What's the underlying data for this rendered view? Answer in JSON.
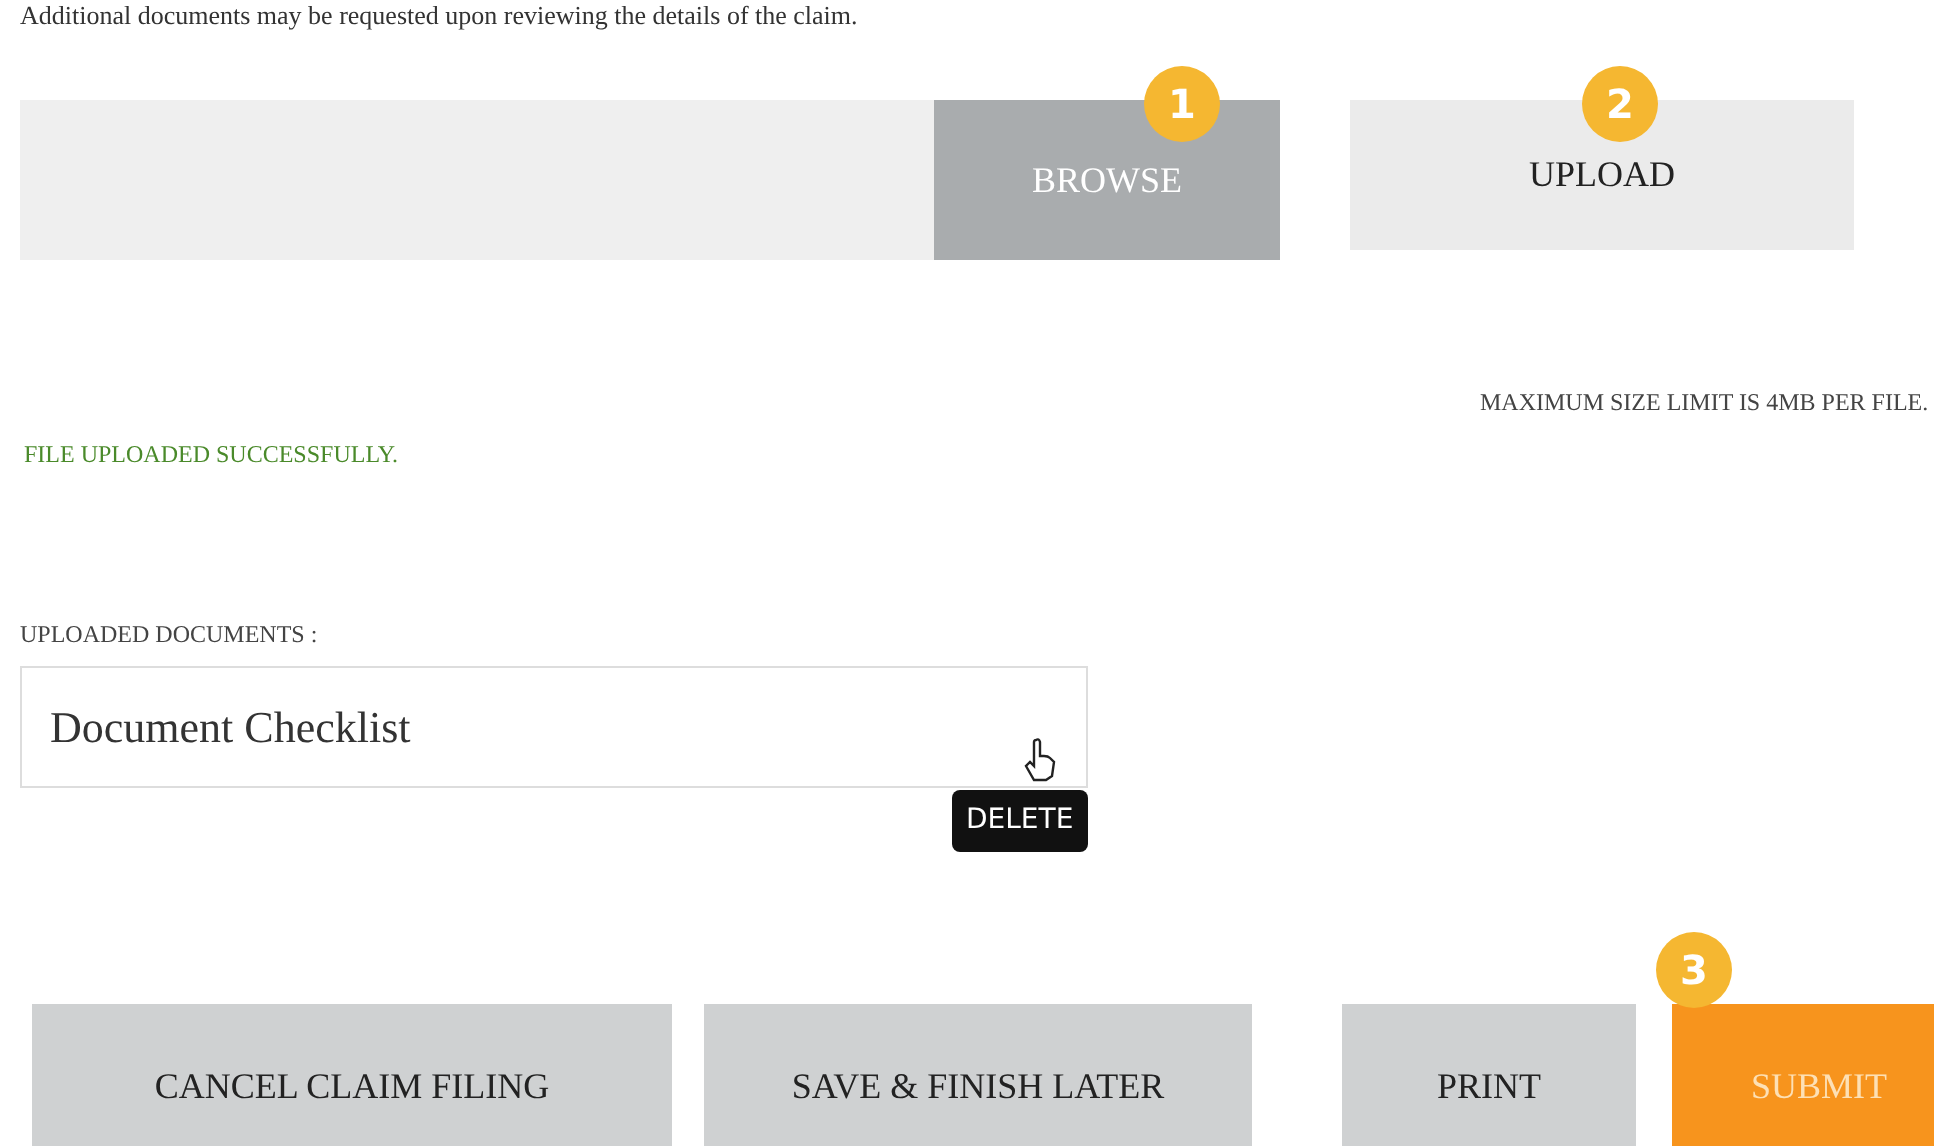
{
  "intro": "Additional documents may be requested upon reviewing the details of the claim.",
  "file_picker": {
    "browse": {
      "label": "BROWSE",
      "disabled": true,
      "step": "1"
    }
  },
  "upload": {
    "label": "UPLOAD",
    "step": "2"
  },
  "size_note": "MAXIMUM SIZE LIMIT IS 4MB PER FILE.",
  "status_message": "FILE UPLOADED SUCCESSFULLY.",
  "uploaded_documents": {
    "label": "UPLOADED DOCUMENTS :",
    "items": [
      {
        "name": "Document Checklist",
        "tooltip": "DELETE"
      }
    ]
  },
  "actions": [
    {
      "label": "CANCEL CLAIM FILING",
      "kind": "secondary"
    },
    {
      "label": "SAVE & FINISH LATER",
      "kind": "secondary"
    },
    {
      "label": "PRINT",
      "kind": "secondary"
    },
    {
      "label": "SUBMIT",
      "kind": "primary",
      "step": "3"
    }
  ]
}
